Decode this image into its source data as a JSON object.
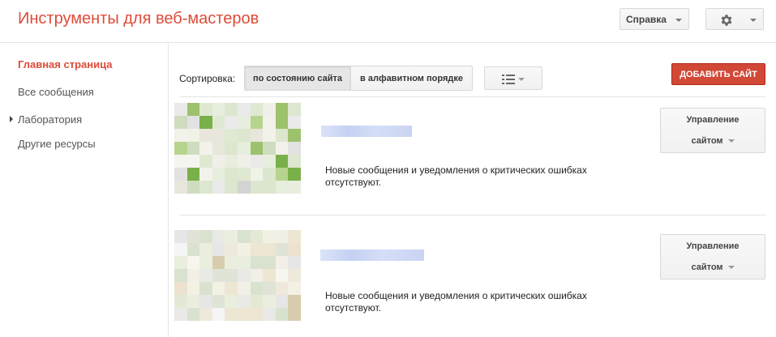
{
  "header": {
    "title": "Инструменты для веб-мастеров",
    "help_label": "Справка",
    "settings_icon": "gear-icon"
  },
  "sidebar": {
    "items": [
      {
        "label": "Главная страница",
        "active": true
      },
      {
        "label": "Все сообщения",
        "active": false
      },
      {
        "label": "Лаборатория",
        "active": false,
        "expandable": true
      },
      {
        "label": "Другие ресурсы",
        "active": false
      }
    ]
  },
  "toolbar": {
    "sort_label": "Сортировка:",
    "sort_by_status": "по состоянию сайта",
    "sort_alpha": "в алфавитном порядке",
    "view_icon": "list-view-icon",
    "add_site_label": "ДОБАВИТЬ САЙТ"
  },
  "sites": [
    {
      "message": "Новые сообщения и уведомления о критических ошибках отсутствуют.",
      "manage_line1": "Управление",
      "manage_line2": "сайтом"
    },
    {
      "message": "Новые сообщения и уведомления о критических ошибках отсутствуют.",
      "manage_line1": "Управление",
      "manage_line2": "сайтом"
    }
  ],
  "colors": {
    "accent": "#dd4b39",
    "add_button": "#d14836"
  }
}
